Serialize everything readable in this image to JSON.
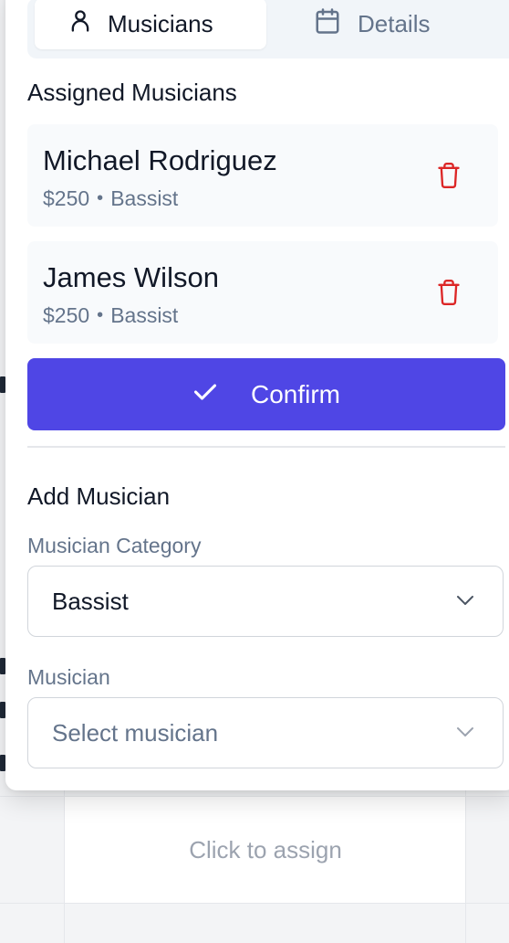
{
  "tabs": [
    {
      "label": "Musicians",
      "icon": "user-icon",
      "active": true
    },
    {
      "label": "Details",
      "icon": "calendar-icon",
      "active": false
    }
  ],
  "assigned": {
    "title": "Assigned Musicians",
    "musicians": [
      {
        "name": "Michael Rodriguez",
        "fee": "$250",
        "separator": "•",
        "role": "Bassist"
      },
      {
        "name": "James Wilson",
        "fee": "$250",
        "separator": "•",
        "role": "Bassist"
      }
    ]
  },
  "confirm": {
    "label": "Confirm",
    "icon": "check-icon"
  },
  "add_musician": {
    "title": "Add Musician",
    "category_label": "Musician Category",
    "category_value": "Bassist",
    "musician_label": "Musician",
    "musician_placeholder": "Select musician"
  },
  "background": {
    "cell_text": "Click to assign"
  },
  "colors": {
    "accent": "#4f46e5",
    "delete": "#dc2626",
    "muted_text": "#64748b"
  }
}
